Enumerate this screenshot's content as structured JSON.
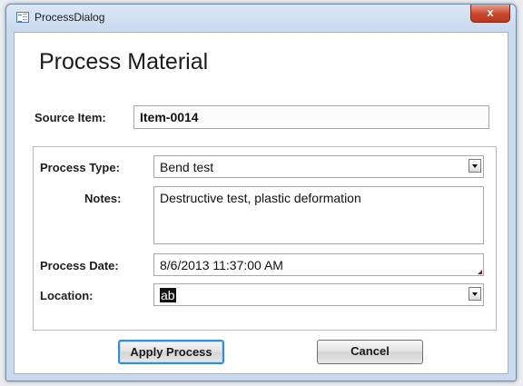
{
  "window": {
    "title": "ProcessDialog",
    "close_label": "x"
  },
  "form": {
    "heading": "Process Material",
    "source_item": {
      "label": "Source Item:",
      "value": "Item-0014"
    },
    "process_type": {
      "label": "Process Type:",
      "value": "Bend test"
    },
    "notes": {
      "label": "Notes:",
      "value": "Destructive test, plastic deformation"
    },
    "process_date": {
      "label": "Process Date:",
      "value": "8/6/2013 11:37:00 AM"
    },
    "location": {
      "label": "Location:",
      "value": "ab"
    }
  },
  "buttons": {
    "apply": "Apply Process",
    "cancel": "Cancel"
  },
  "colors": {
    "title_bar": "#c9d9ee",
    "close_button": "#c9452b",
    "default_button_border": "#3a8ad4",
    "selection": "#111111"
  },
  "icons": {
    "app": "form-icon",
    "close": "close-icon",
    "dropdown": "chevron-down-icon"
  }
}
